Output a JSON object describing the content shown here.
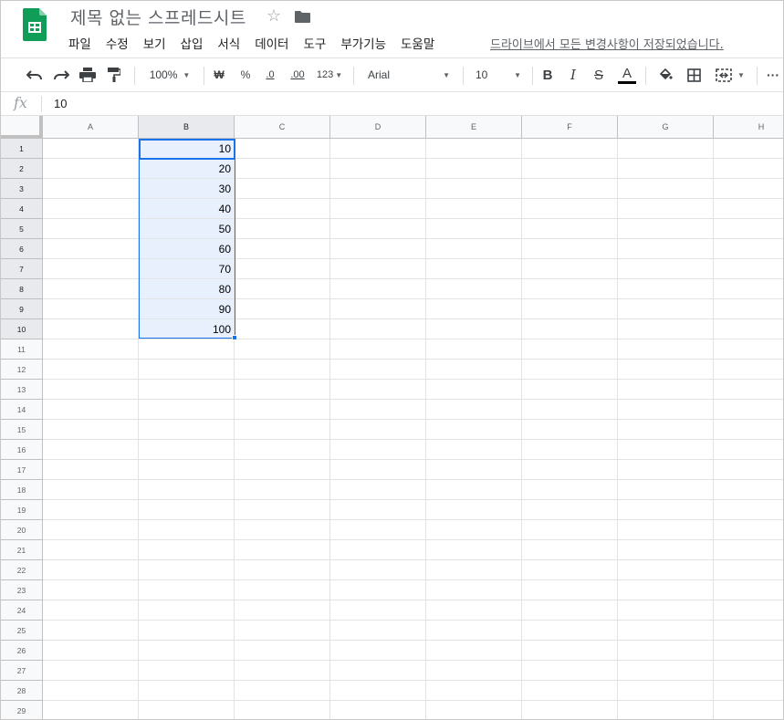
{
  "header": {
    "title": "제목 없는 스프레드시트",
    "menu": [
      "파일",
      "수정",
      "보기",
      "삽입",
      "서식",
      "데이터",
      "도구",
      "부가기능",
      "도움말"
    ],
    "save_status": "드라이브에서 모든 변경사항이 저장되었습니다."
  },
  "toolbar": {
    "zoom": "100%",
    "currency": "₩",
    "percent": "%",
    "decrease_decimal": ".0",
    "increase_decimal": ".00",
    "number_format": "123",
    "font": "Arial",
    "font_size": "10",
    "bold": "B",
    "italic": "I",
    "strikethrough": "S",
    "text_color_label": "A",
    "more": "···",
    "text_color": "#000000"
  },
  "formula_bar": {
    "fx_label": "fx",
    "value": "10"
  },
  "sheet": {
    "columns": [
      "A",
      "B",
      "C",
      "D",
      "E",
      "F",
      "G",
      "H"
    ],
    "rows": [
      "1",
      "2",
      "3",
      "4",
      "5",
      "6",
      "7",
      "8",
      "9",
      "10",
      "11",
      "12",
      "13",
      "14",
      "15",
      "16",
      "17",
      "18",
      "19",
      "20",
      "21",
      "22",
      "23",
      "24",
      "25",
      "26",
      "27",
      "28",
      "29"
    ],
    "column_b_values": [
      "10",
      "20",
      "30",
      "40",
      "50",
      "60",
      "70",
      "80",
      "90",
      "100"
    ],
    "selection_color": "#1a73e8",
    "selection_fill": "#e8f0fe"
  },
  "icons": {
    "logo": "sheets-logo-icon",
    "star": "star-icon",
    "folder": "folder-icon"
  }
}
